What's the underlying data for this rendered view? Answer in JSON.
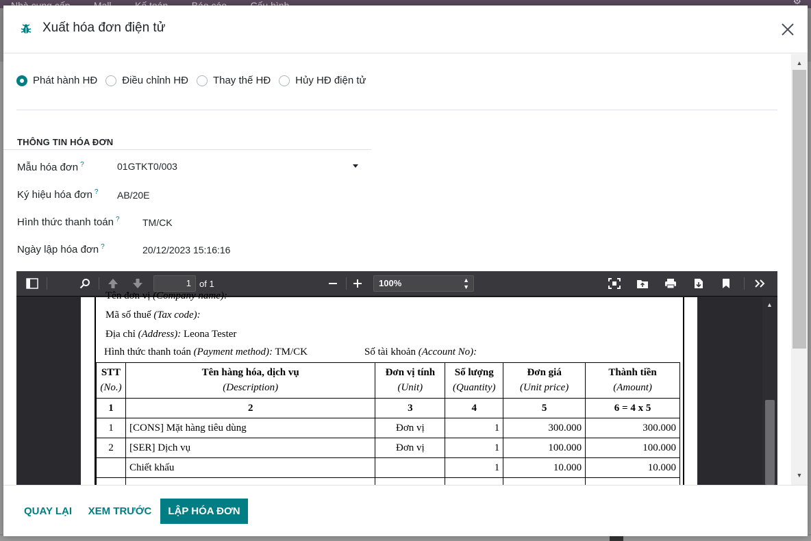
{
  "background": {
    "nav_items": [
      "Nhà cung cấp",
      "Mall",
      "Kế toán",
      "Báo cáo",
      "Cấu hình"
    ]
  },
  "dialog": {
    "title": "Xuất hóa đơn điện tử",
    "icon": "bug-icon",
    "radio_options": [
      {
        "label": "Phát hành HĐ",
        "checked": true
      },
      {
        "label": "Điều chỉnh HĐ",
        "checked": false
      },
      {
        "label": "Thay thế HĐ",
        "checked": false
      },
      {
        "label": "Hủy HĐ điện tử",
        "checked": false
      }
    ],
    "section_title": "THÔNG TIN HÓA ĐƠN",
    "fields": {
      "template": {
        "label": "Mẫu hóa đơn",
        "value": "01GTKT0/003",
        "help": "?"
      },
      "symbol": {
        "label": "Ký hiệu hóa đơn",
        "value": "AB/20E",
        "help": "?"
      },
      "payment": {
        "label": "Hình thức thanh toán",
        "value": "TM/CK",
        "help": "?"
      },
      "date": {
        "label": "Ngày lập hóa đơn",
        "value": "20/12/2023 15:16:16",
        "help": "?"
      }
    },
    "footer": {
      "back": "QUAY LẠI",
      "preview": "XEM TRƯỚC",
      "create": "LẬP HÓA ĐƠN"
    },
    "accent_color": "#017e84"
  },
  "pdf_viewer": {
    "page_number": "1",
    "page_of": "of 1",
    "zoom": "100%",
    "document": {
      "company_line": {
        "label": "Tên đơn vị",
        "label_en": "(Company name):"
      },
      "tax_line": {
        "label": "Mã số thuế",
        "label_en": "(Tax code):"
      },
      "address_line": {
        "label": "Địa chỉ",
        "label_en": "(Address):",
        "value": "Leona Tester"
      },
      "payment_line": {
        "label": "Hình thức thanh toán",
        "label_en": "(Payment method):",
        "value": "TM/CK"
      },
      "account_line": {
        "label": "Số tài khoản",
        "label_en": "(Account No):"
      },
      "table": {
        "headers": [
          {
            "vi": "STT",
            "en": "(No.)"
          },
          {
            "vi": "Tên hàng hóa, dịch vụ",
            "en": "(Description)"
          },
          {
            "vi": "Đơn vị tính",
            "en": "(Unit)"
          },
          {
            "vi": "Số lượng",
            "en": "(Quantity)"
          },
          {
            "vi": "Đơn giá",
            "en": "(Unit price)"
          },
          {
            "vi": "Thành tiền",
            "en": "(Amount)"
          }
        ],
        "index_row": [
          "1",
          "2",
          "3",
          "4",
          "5",
          "6 = 4 x 5"
        ],
        "rows": [
          {
            "no": "1",
            "desc": "[CONS] Mặt hàng tiêu dùng",
            "unit": "Đơn vị",
            "qty": "1",
            "price": "300.000",
            "amount": "300.000"
          },
          {
            "no": "2",
            "desc": "[SER] Dịch vụ",
            "unit": "Đơn vị",
            "qty": "1",
            "price": "100.000",
            "amount": "100.000"
          },
          {
            "no": "",
            "desc": "Chiết khấu",
            "unit": "",
            "qty": "1",
            "price": "10.000",
            "amount": "10.000"
          }
        ]
      }
    }
  }
}
